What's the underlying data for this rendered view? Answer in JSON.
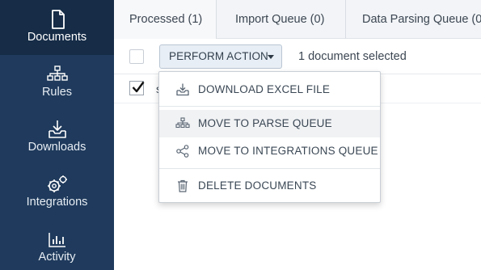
{
  "sidebar": {
    "items": [
      {
        "label": "Documents",
        "icon": "document-icon",
        "active": true
      },
      {
        "label": "Rules",
        "icon": "hierarchy-icon",
        "active": false
      },
      {
        "label": "Downloads",
        "icon": "download-tray-icon",
        "active": false
      },
      {
        "label": "Integrations",
        "icon": "gears-icon",
        "active": false
      },
      {
        "label": "Activity",
        "icon": "bar-chart-icon",
        "active": false
      }
    ]
  },
  "tabs": [
    {
      "label": "Processed (1)",
      "active": true
    },
    {
      "label": "Import Queue (0)",
      "active": false
    },
    {
      "label": "Data Parsing Queue (0",
      "active": false
    }
  ],
  "toolbar": {
    "perform_action_label": "PERFORM ACTION",
    "selection_text": "1 document selected"
  },
  "row": {
    "text": "s"
  },
  "dropdown": {
    "items": [
      {
        "label": "DOWNLOAD EXCEL FILE",
        "icon": "download-icon"
      },
      {
        "label": "MOVE TO PARSE QUEUE",
        "icon": "hierarchy-icon",
        "hovered": true
      },
      {
        "label": "MOVE TO INTEGRATIONS QUEUE",
        "icon": "share-icon"
      },
      {
        "label": "DELETE DOCUMENTS",
        "icon": "trash-icon"
      }
    ]
  },
  "colors": {
    "sidebar_bg": "#1f3a5c",
    "sidebar_active_bg": "#162c47",
    "tab_bar_bg": "#f2f4f7",
    "button_bg": "#e8eef5"
  }
}
